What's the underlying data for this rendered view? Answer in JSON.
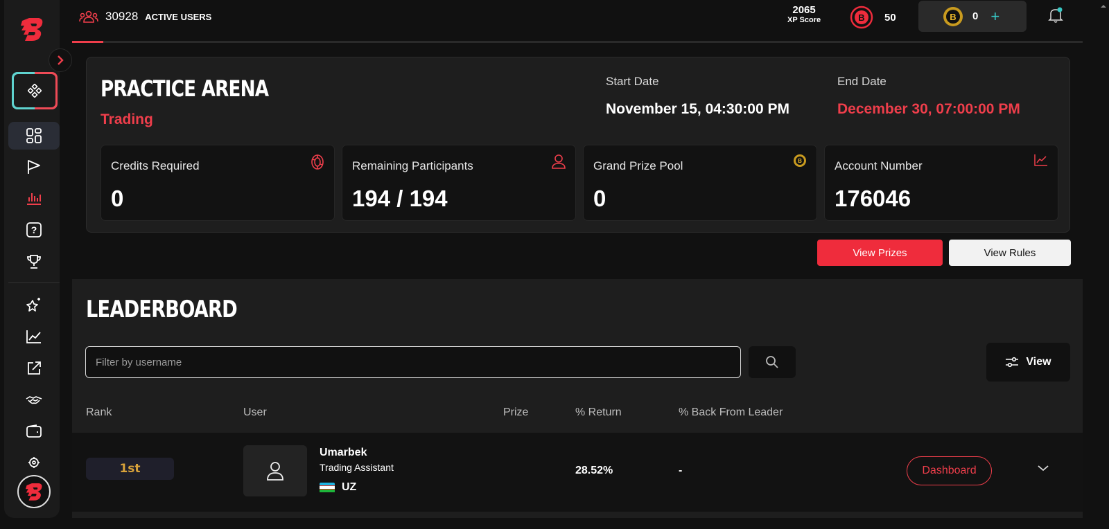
{
  "topbar": {
    "active_users_count": "30928",
    "active_users_label": "ACTIVE USERS",
    "xp_value": "2065",
    "xp_label": "XP Score",
    "credits": "50",
    "coins": "0",
    "add_symbol": "+"
  },
  "arena": {
    "title": "PRACTICE ARENA",
    "subtitle": "Trading",
    "start_label": "Start Date",
    "start_value": "November 15, 04:30:00 PM",
    "end_label": "End Date",
    "end_value": "December 30, 07:00:00 PM",
    "cards": [
      {
        "label": "Credits Required",
        "value": "0",
        "icon": "credit-chip-icon"
      },
      {
        "label": "Remaining Participants",
        "value": "194 / 194",
        "icon": "person-icon"
      },
      {
        "label": "Grand Prize Pool",
        "value": "0",
        "icon": "coin-icon"
      },
      {
        "label": "Account Number",
        "value": "176046",
        "icon": "line-chart-icon"
      }
    ]
  },
  "actions": {
    "view_prizes": "View Prizes",
    "view_rules": "View Rules"
  },
  "leaderboard": {
    "title": "LEADERBOARD",
    "filter_placeholder": "Filter by username",
    "view_label": "View",
    "columns": [
      "Rank",
      "User",
      "Prize",
      "% Return",
      "% Back From Leader"
    ],
    "rows": [
      {
        "rank": "1st",
        "username": "Umarbek",
        "role": "Trading Assistant",
        "country": "UZ",
        "prize": "",
        "return": "28.52%",
        "back_from_leader": "-",
        "action": "Dashboard"
      }
    ]
  },
  "colors": {
    "accent_red": "#ef3e4b",
    "teal": "#37c8c5",
    "gold": "#d8a23a"
  }
}
